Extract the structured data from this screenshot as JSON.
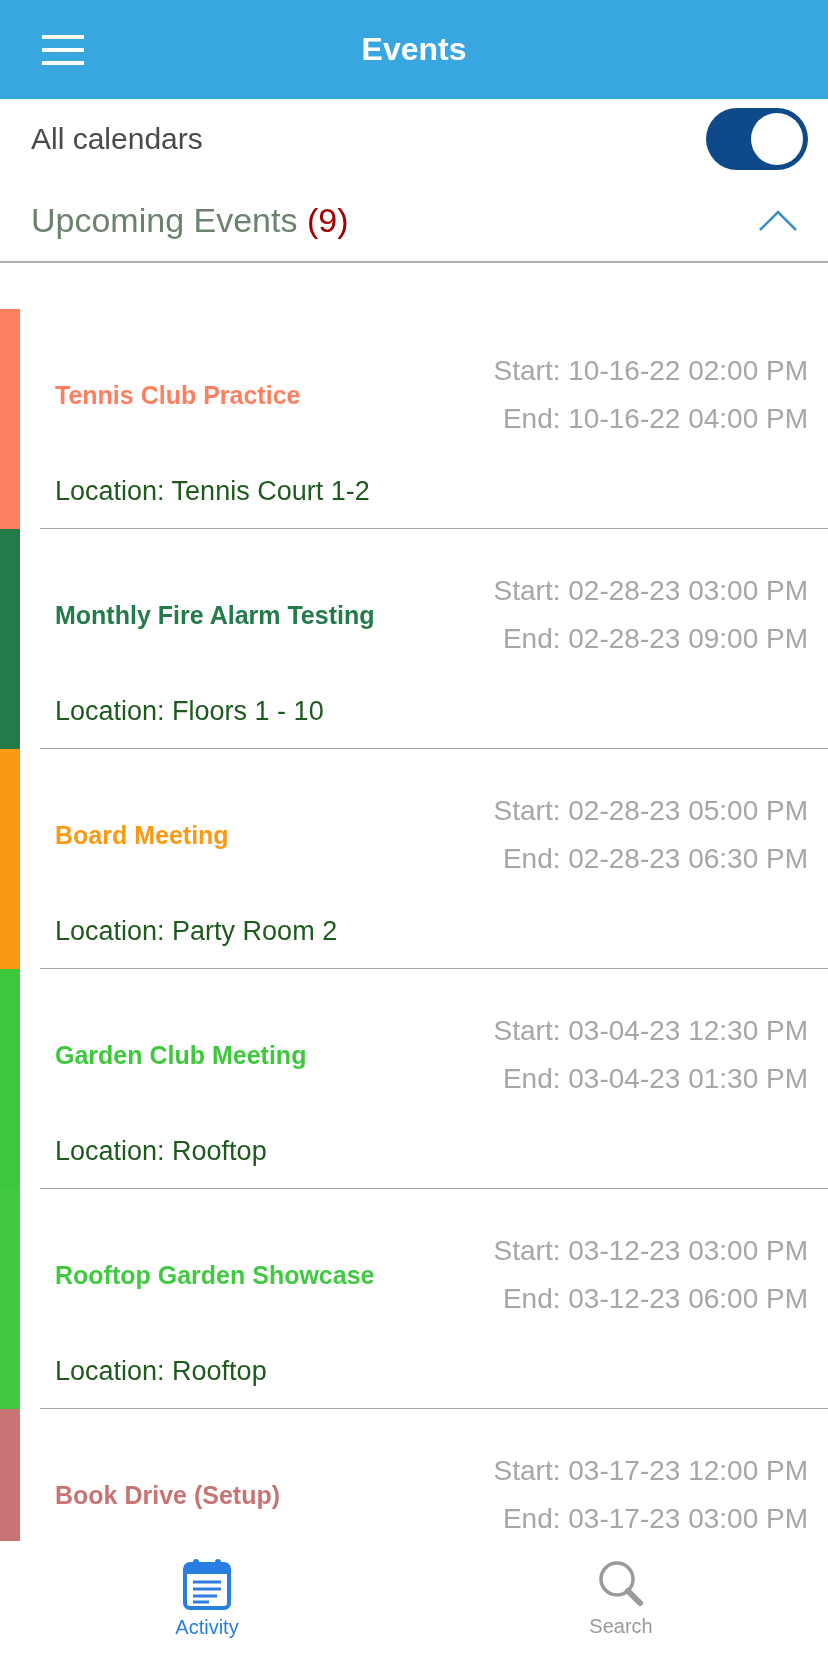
{
  "header": {
    "title": "Events"
  },
  "calendars_toggle": {
    "label": "All calendars",
    "on": true
  },
  "section": {
    "title": "Upcoming Events",
    "count": "(9)",
    "expanded": true
  },
  "events": [
    {
      "title": "Tennis Club Practice",
      "color": "#fe7f5f",
      "start": "Start: 10-16-22 02:00 PM",
      "end": "End: 10-16-22 04:00 PM",
      "location": "Location: Tennis Court 1-2"
    },
    {
      "title": "Monthly Fire Alarm Testing",
      "color": "#237a4a",
      "start": "Start: 02-28-23 03:00 PM",
      "end": "End: 02-28-23 09:00 PM",
      "location": "Location: Floors 1 - 10"
    },
    {
      "title": "Board Meeting",
      "color": "#f99a12",
      "start": "Start: 02-28-23 05:00 PM",
      "end": "End: 02-28-23 06:30 PM",
      "location": "Location: Party Room 2"
    },
    {
      "title": "Garden Club Meeting",
      "color": "#3ec83e",
      "start": "Start: 03-04-23 12:30 PM",
      "end": "End: 03-04-23 01:30 PM",
      "location": "Location: Rooftop"
    },
    {
      "title": "Rooftop Garden Showcase",
      "color": "#42c942",
      "start": "Start: 03-12-23 03:00 PM",
      "end": "End: 03-12-23 06:00 PM",
      "location": "Location: Rooftop"
    },
    {
      "title": "Book Drive (Setup)",
      "color": "#c87474",
      "start": "Start: 03-17-23 12:00 PM",
      "end": "End: 03-17-23 03:00 PM"
    }
  ],
  "tabs": [
    {
      "label": "Activity",
      "kind": "calendar",
      "selected": true
    },
    {
      "label": "Search",
      "kind": "search",
      "selected": false
    }
  ]
}
